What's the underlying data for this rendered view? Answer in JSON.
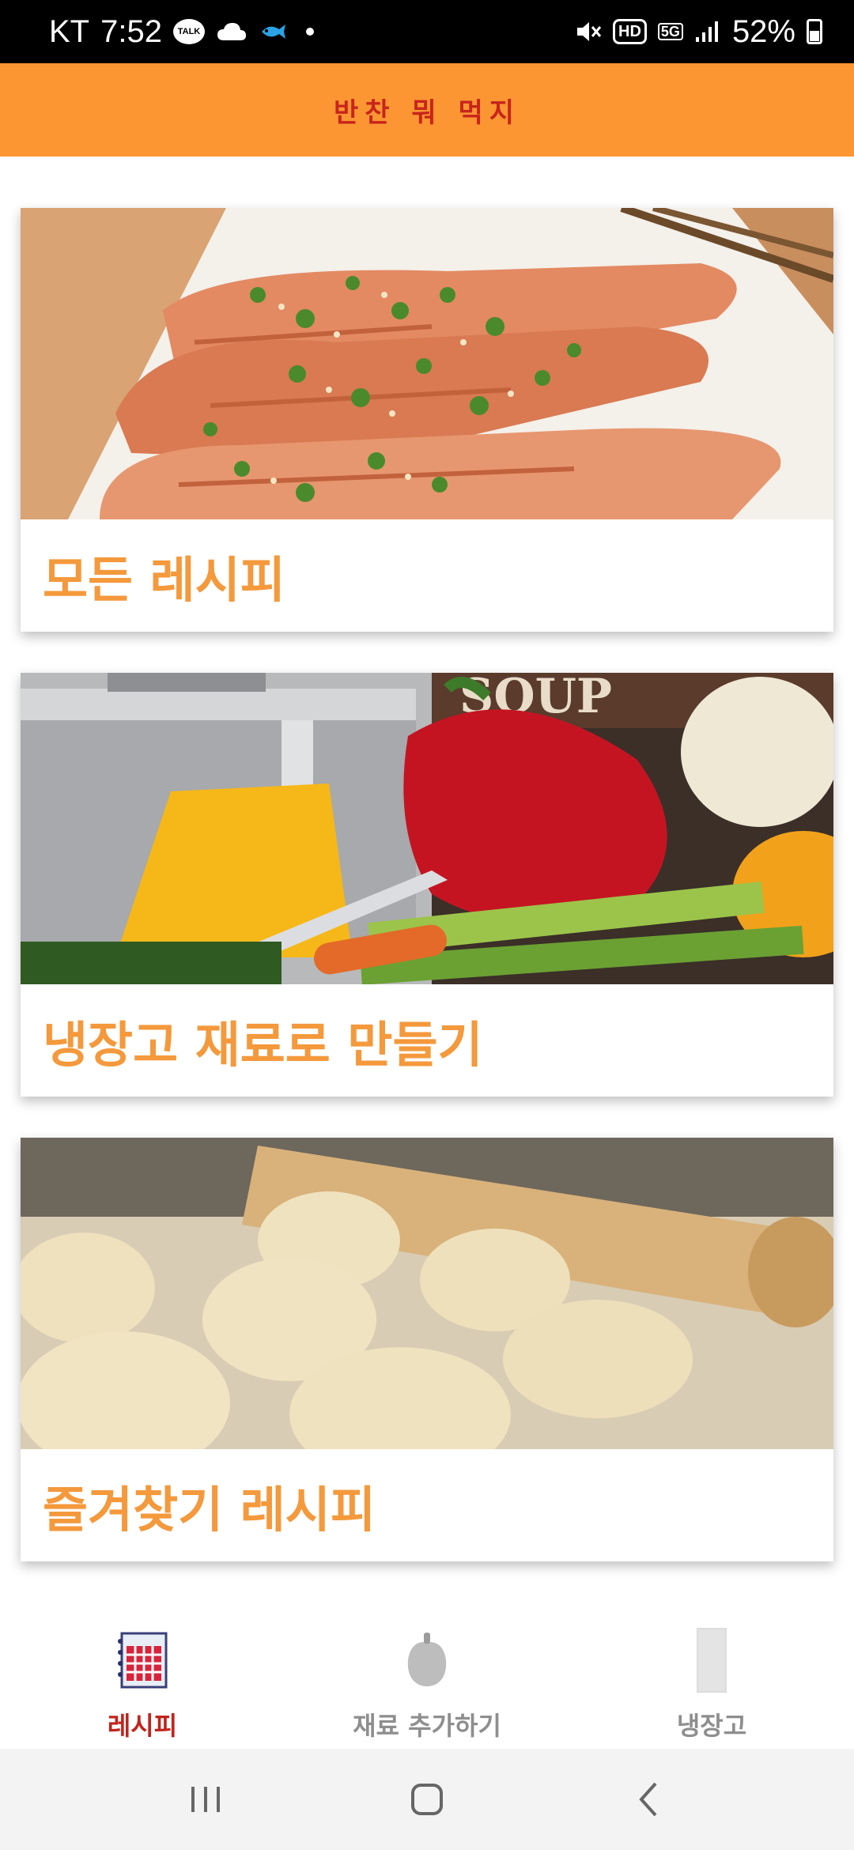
{
  "status_bar": {
    "carrier": "KT",
    "time": "7:52",
    "talk_label": "TALK",
    "hd_label": "HD",
    "fiveg_label": "5G",
    "battery": "52%",
    "icons": [
      "kakaotalk-icon",
      "cloud-icon",
      "fish-icon",
      "mute-icon",
      "signal-icon",
      "battery-icon"
    ]
  },
  "app_bar": {
    "title": "반찬 뭐 먹지",
    "color": "#fb9633",
    "title_color": "#c8241c"
  },
  "cards": [
    {
      "label": "모든 레시피",
      "image": "grilled-salmon-photo"
    },
    {
      "label": "냉장고 재료로 만들기",
      "image": "vegetables-and-pot-photo"
    },
    {
      "label": "즐겨찾기 레시피",
      "image": "dough-and-rolling-pin-photo"
    }
  ],
  "accent_color": "#f4993c",
  "bottom_nav": {
    "items": [
      {
        "label": "레시피",
        "icon": "recipe-book-icon",
        "active": true
      },
      {
        "label": "재료 추가하기",
        "icon": "pepper-icon",
        "active": false
      },
      {
        "label": "냉장고",
        "icon": "fridge-icon",
        "active": false
      }
    ],
    "active_color": "#c0241c",
    "inactive_color": "#8e8e8e"
  },
  "system_nav": {
    "buttons": [
      "recent-apps-icon",
      "home-icon",
      "back-icon"
    ]
  }
}
